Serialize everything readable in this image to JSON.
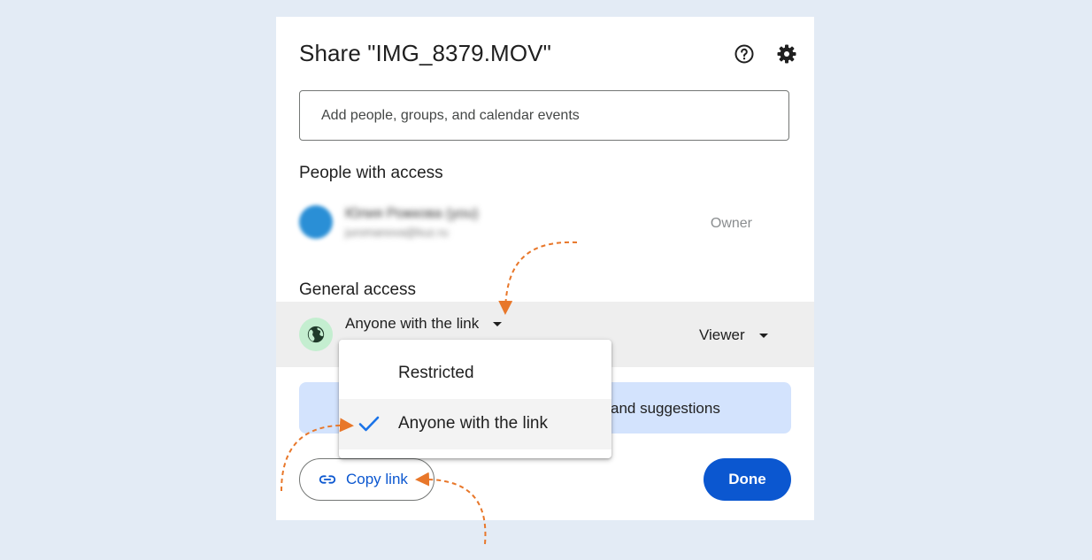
{
  "dialog": {
    "title": "Share \"IMG_8379.MOV\"",
    "help_icon": "help-circle-icon",
    "settings_icon": "gear-icon"
  },
  "add_people": {
    "placeholder": "Add people, groups, and calendar events"
  },
  "people_section": {
    "title": "People with access",
    "person": {
      "name": "Юлия Рожкова (you)",
      "email": "juromanova@kuz.ru",
      "role": "Owner"
    }
  },
  "general_access": {
    "title": "General access",
    "selected_option": "Anyone with the link",
    "role": "Viewer",
    "globe_icon": "globe-icon"
  },
  "dropdown": {
    "options": [
      {
        "label": "Restricted",
        "selected": false
      },
      {
        "label": "Anyone with the link",
        "selected": true
      }
    ]
  },
  "banner": {
    "visible_text": "and suggestions"
  },
  "actions": {
    "copy_link_label": "Copy link",
    "done_label": "Done"
  },
  "colors": {
    "page_background": "#e3ebf5",
    "primary_blue": "#0b57d0",
    "banner_blue": "#d3e3fd",
    "globe_green": "#c4eed0",
    "annotation_orange": "#e8772a"
  }
}
